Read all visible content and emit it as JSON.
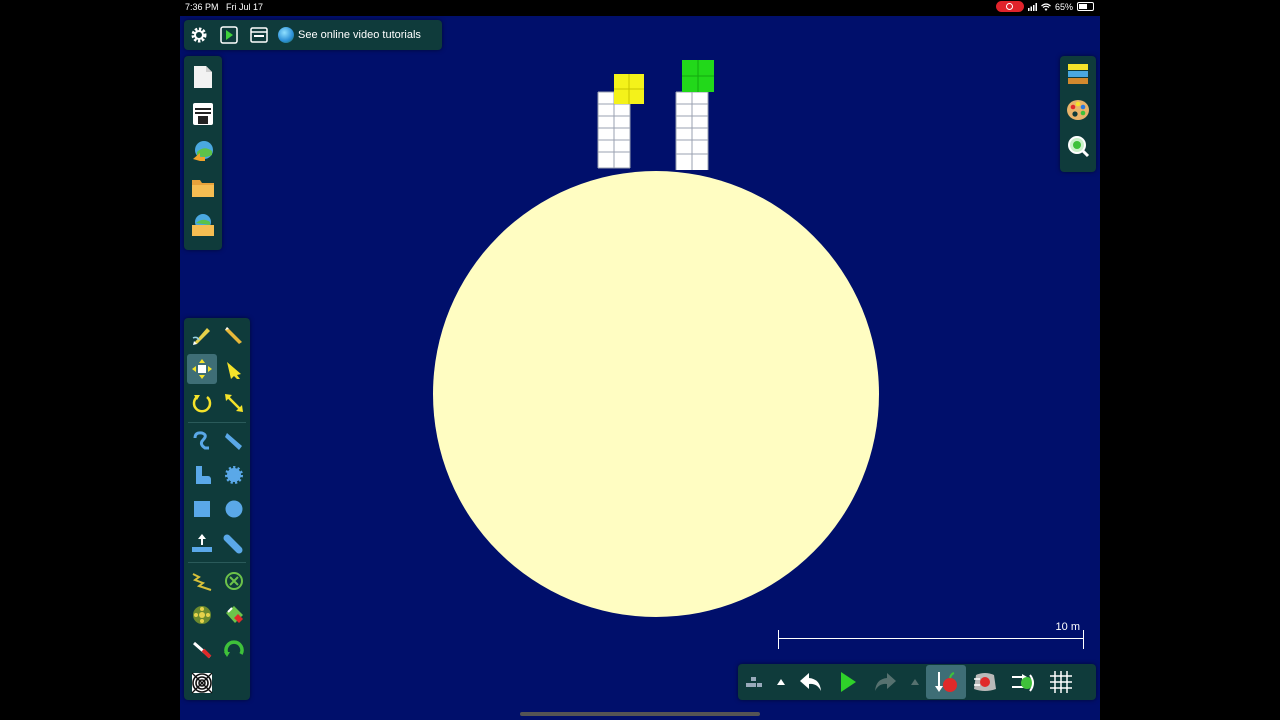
{
  "status_bar": {
    "time": "7:36 PM",
    "date": "Fri Jul 17",
    "battery": "65%"
  },
  "top_bar": {
    "tutorial_label": "See online video tutorials"
  },
  "scale_bar": {
    "label": "10 m"
  },
  "colors": {
    "background": "#000f6b",
    "panel": "#0f3b3b",
    "planet": "#fffdc2",
    "box_yellow": "#f4f21a",
    "box_green": "#22d81a"
  },
  "icons": {
    "top_bar": [
      "gear-icon",
      "play-scene-icon",
      "window-icon",
      "globe-icon"
    ],
    "file_panel": [
      "new-scene-icon",
      "save-scene-icon",
      "browse-online-icon",
      "open-folder-icon",
      "open-shared-folder-icon"
    ],
    "right_panel": [
      "background-layers-icon",
      "palette-icon",
      "zoom-icon"
    ],
    "tools": [
      "sketch-tool-icon",
      "cut-tool-icon",
      "move-tool-icon",
      "drag-tool-icon",
      "rotate-tool-icon",
      "scale-tool-icon",
      "rope-tool-icon",
      "brush-tool-icon",
      "polygon-tool-icon",
      "gear-shape-icon",
      "box-tool-icon",
      "circle-tool-icon",
      "plane-tool-icon",
      "chain-tool-icon",
      "spring-tool-icon",
      "fixate-tool-icon",
      "hinge-tool-icon",
      "thruster-tool-icon",
      "laser-tool-icon",
      "tracer-tool-icon",
      "texture-tool-icon"
    ],
    "bottom_bar": [
      "grid-menu-icon",
      "up-arrow-icon",
      "undo-icon",
      "play-icon",
      "redo-icon",
      "up-arrow-icon",
      "gravity-icon",
      "air-friction-icon",
      "controllers-icon",
      "grid-icon"
    ]
  }
}
